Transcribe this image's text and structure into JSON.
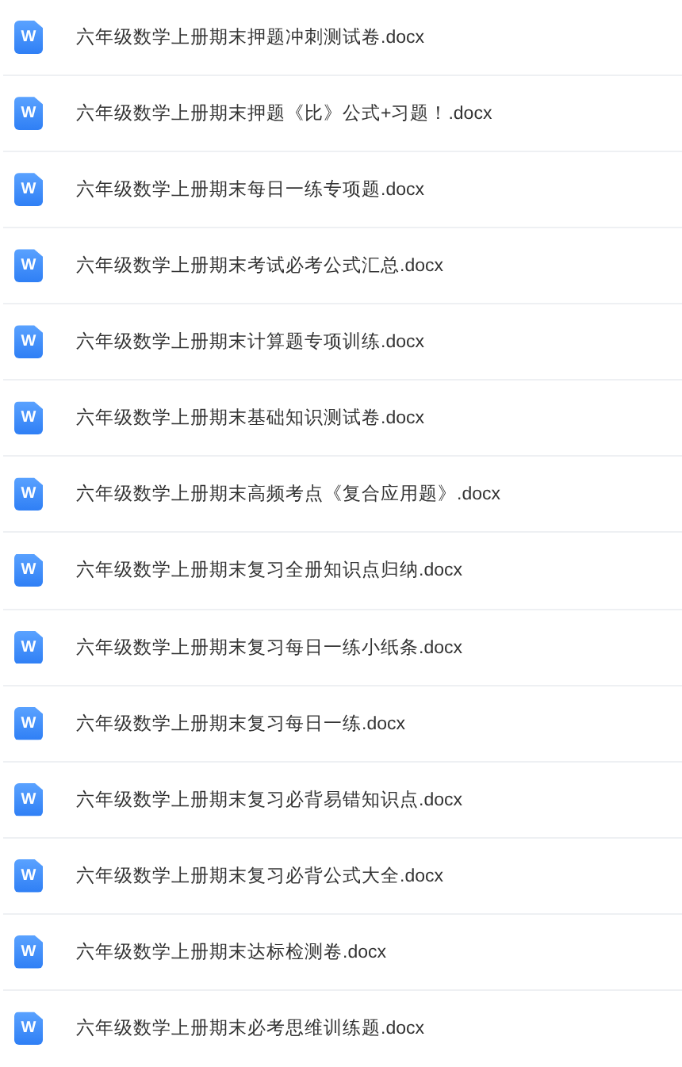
{
  "files": [
    {
      "icon_letter": "W",
      "name": "六年级数学上册期末押题冲刺测试卷.docx"
    },
    {
      "icon_letter": "W",
      "name": "六年级数学上册期末押题《比》公式+习题！.docx"
    },
    {
      "icon_letter": "W",
      "name": "六年级数学上册期末每日一练专项题.docx"
    },
    {
      "icon_letter": "W",
      "name": "六年级数学上册期末考试必考公式汇总.docx"
    },
    {
      "icon_letter": "W",
      "name": "六年级数学上册期末计算题专项训练.docx"
    },
    {
      "icon_letter": "W",
      "name": "六年级数学上册期末基础知识测试卷.docx"
    },
    {
      "icon_letter": "W",
      "name": "六年级数学上册期末高频考点《复合应用题》.docx"
    },
    {
      "icon_letter": "W",
      "name": "六年级数学上册期末复习全册知识点归纳.docx"
    },
    {
      "icon_letter": "W",
      "name": "六年级数学上册期末复习每日一练小纸条.docx"
    },
    {
      "icon_letter": "W",
      "name": "六年级数学上册期末复习每日一练.docx"
    },
    {
      "icon_letter": "W",
      "name": "六年级数学上册期末复习必背易错知识点.docx"
    },
    {
      "icon_letter": "W",
      "name": "六年级数学上册期末复习必背公式大全.docx"
    },
    {
      "icon_letter": "W",
      "name": "六年级数学上册期末达标检测卷.docx"
    },
    {
      "icon_letter": "W",
      "name": "六年级数学上册期末必考思维训练题.docx"
    }
  ]
}
